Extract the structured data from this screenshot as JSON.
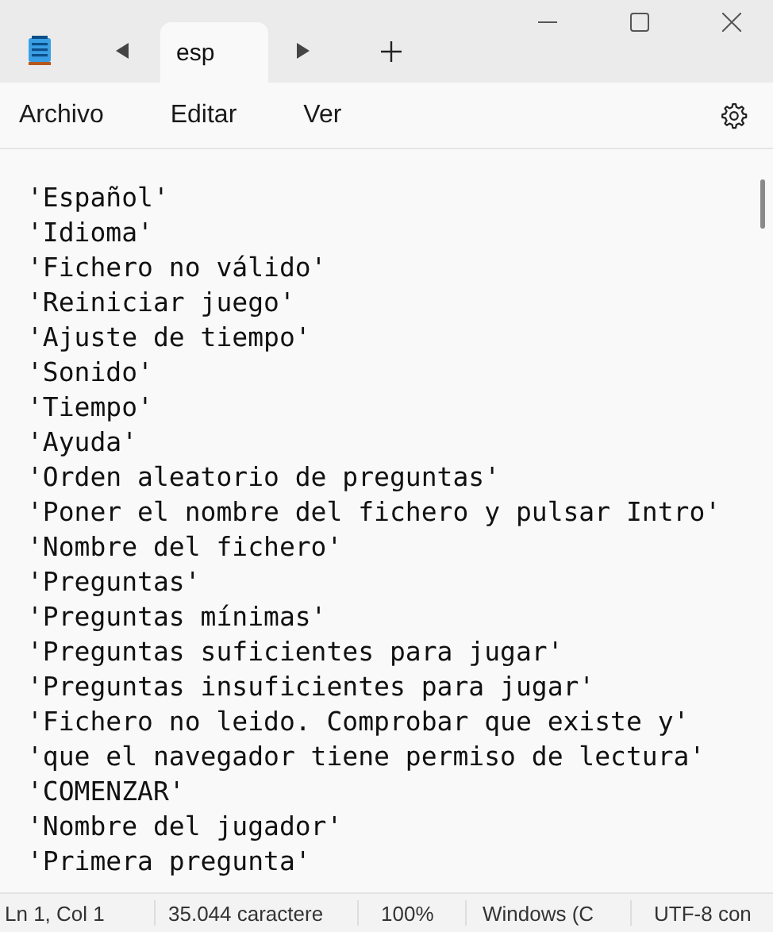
{
  "tabs": [
    {
      "label": "esp",
      "selected": true
    }
  ],
  "menu": [
    "Archivo",
    "Editar",
    "Ver"
  ],
  "lines": [
    "'Español'",
    "'Idioma'",
    "'Fichero no válido'",
    "'Reiniciar juego'",
    "'Ajuste de tiempo'",
    "'Sonido'",
    "'Tiempo'",
    "'Ayuda'",
    "'Orden aleatorio de preguntas'",
    "'Poner el nombre del fichero y pulsar Intro'",
    "'Nombre del fichero'",
    "'Preguntas'",
    "'Preguntas mínimas'",
    "'Preguntas suficientes para jugar'",
    "'Preguntas insuficientes para jugar'",
    "'Fichero no leido. Comprobar que existe y'",
    "'que el navegador tiene permiso de lectura'",
    "'COMENZAR'",
    "'Nombre del jugador'",
    "'Primera pregunta'"
  ],
  "status_bar": [
    "Ln 1, Col 1",
    "35.044 caractere",
    "100%",
    "Windows (C",
    "UTF-8 con"
  ]
}
